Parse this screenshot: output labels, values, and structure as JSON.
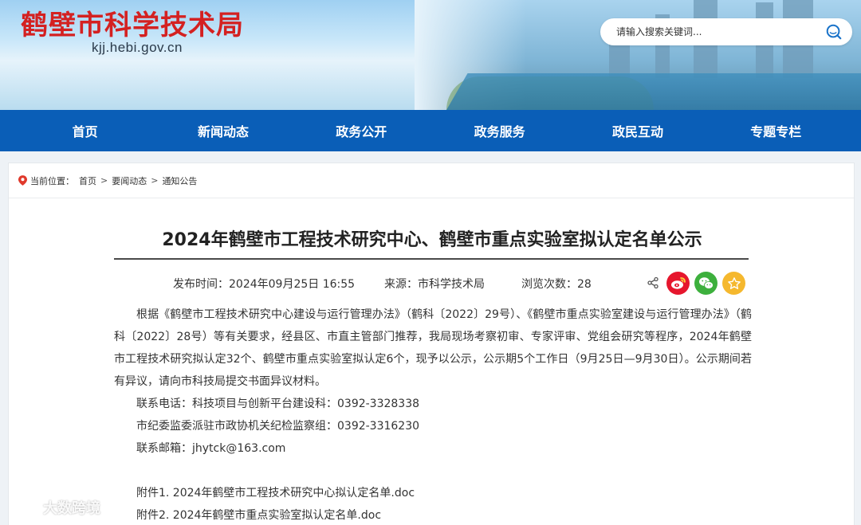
{
  "header": {
    "site_title": "鹤壁市科学技术局",
    "site_domain": "kjj.hebi.gov.cn",
    "search_placeholder": "请输入搜索关键词...",
    "search_icon": "search-icon"
  },
  "nav": {
    "items": [
      {
        "label": "首页"
      },
      {
        "label": "新闻动态"
      },
      {
        "label": "政务公开"
      },
      {
        "label": "政务服务"
      },
      {
        "label": "政民互动"
      },
      {
        "label": "专题专栏"
      }
    ]
  },
  "breadcrumb": {
    "prefix": "当前位置：",
    "items": [
      "首页",
      "要闻动态",
      "通知公告"
    ],
    "separator": ">"
  },
  "article": {
    "title": "2024年鹤壁市工程技术研究中心、鹤壁市重点实验室拟认定名单公示",
    "publish": "发布时间：2024年09月25日 16:55",
    "source": "来源：市科学技术局",
    "views": "浏览次数：28",
    "share": {
      "icons": [
        "share-icon",
        "weibo-icon",
        "wechat-icon",
        "favorite-icon"
      ]
    },
    "paragraph": "根据《鹤壁市工程技术研究中心建设与运行管理办法》（鹤科〔2022〕29号）、《鹤壁市重点实验室建设与运行管理办法》（鹤科〔2022〕28号）等有关要求，经县区、市直主管部门推荐，我局现场考察初审、专家评审、党组会研究等程序，2024年鹤壁市工程技术研究拟认定32个、鹤壁市重点实验室拟认定6个，现予以公示，公示期5个工作日（9月25日—9月30日）。公示期间若有异议，请向市科技局提交书面异议材料。",
    "contact_phone": "联系电话：科技项目与创新平台建设科：0392-3328338",
    "discipline_phone": "市纪委监委派驻市政协机关纪检监察组：0392-3316230",
    "email": "联系邮箱：jhytck@163.com",
    "attachments": [
      "附件1. 2024年鹤壁市工程技术研究中心拟认定名单.doc",
      "附件2. 2024年鹤壁市重点实验室拟认定名单.doc"
    ]
  },
  "watermark": {
    "text": "大数跨境"
  },
  "colors": {
    "title_red": "#d42121",
    "nav_blue": "#0a5eb7",
    "weibo_red": "#e6162d",
    "wechat_green": "#3db03d",
    "favorite_yellow": "#f5b82e"
  }
}
